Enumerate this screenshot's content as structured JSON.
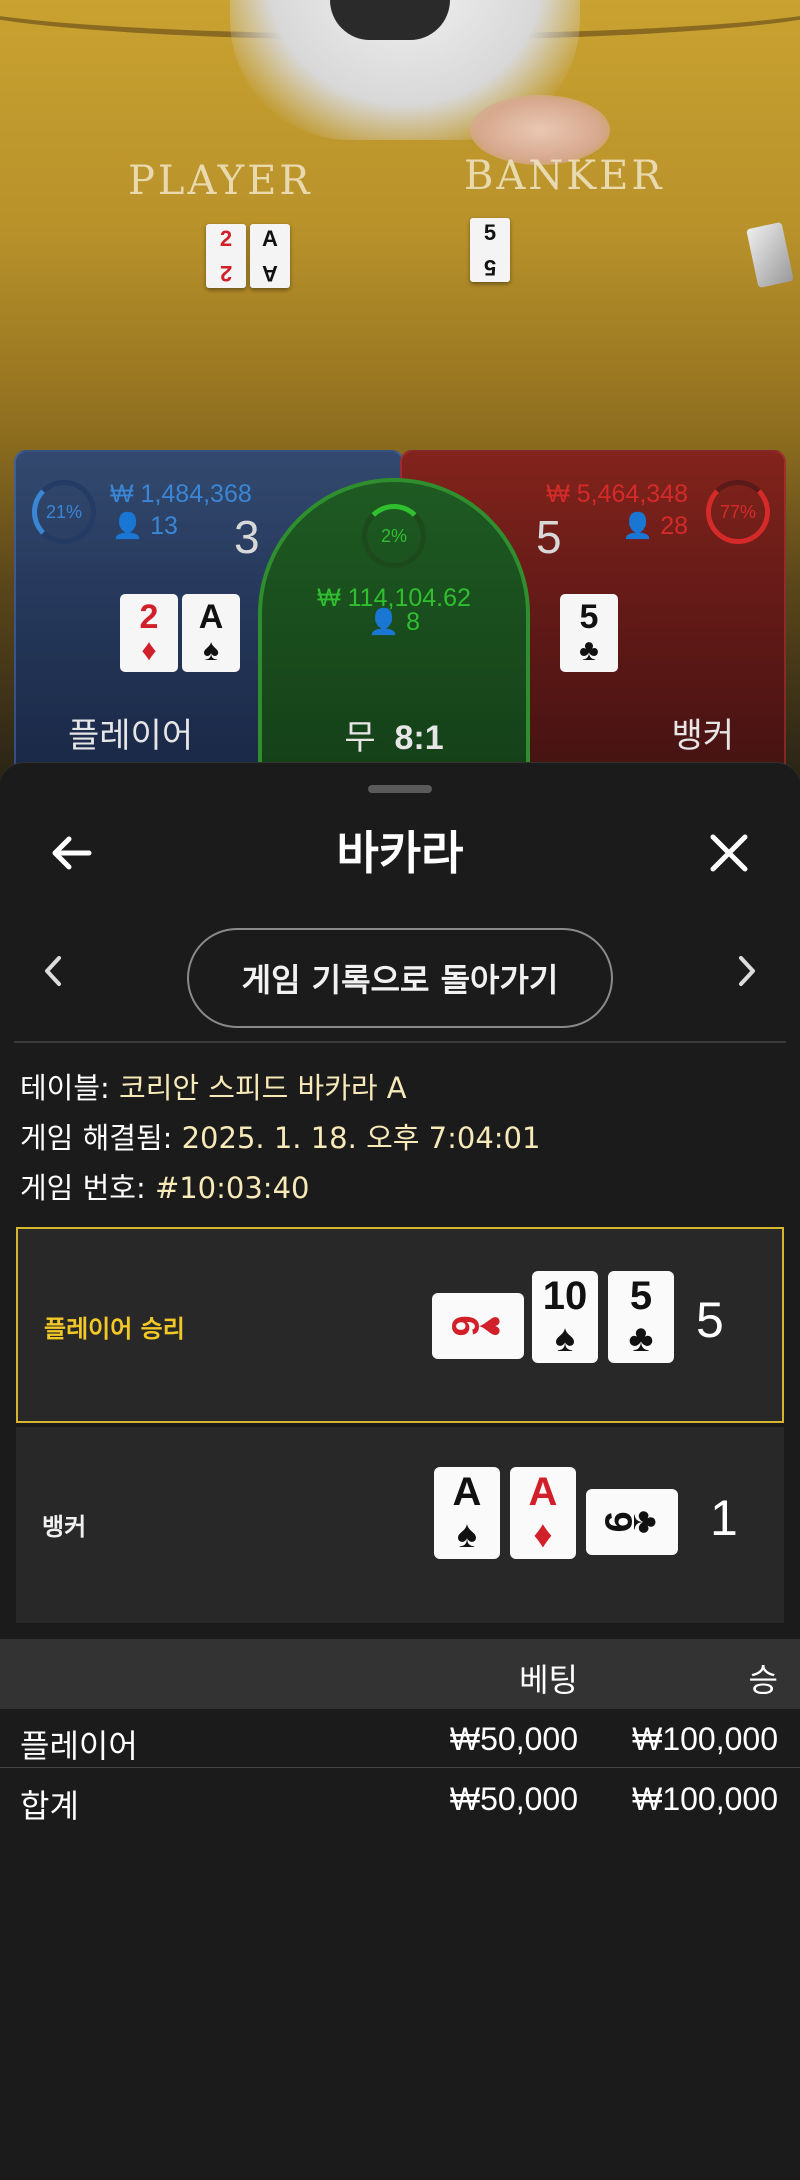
{
  "table_view": {
    "felt_player_label": "PLAYER",
    "felt_banker_label": "BANKER",
    "felt_player_cards": [
      {
        "rank": "2",
        "suit": "♦",
        "color": "red"
      },
      {
        "rank": "A",
        "suit": "♠",
        "color": "black"
      }
    ],
    "felt_banker_cards": [
      {
        "rank": "5",
        "suit": "♣",
        "color": "black"
      }
    ]
  },
  "bet_spots": {
    "player": {
      "percent": "21%",
      "amount": "₩ 1,484,368",
      "bettors": "13",
      "score": "3",
      "name": "플레이어",
      "cards": [
        {
          "rank": "2",
          "suit": "♦",
          "color": "red"
        },
        {
          "rank": "A",
          "suit": "♠",
          "color": "black"
        }
      ],
      "color": "#3a86d6"
    },
    "tie": {
      "percent": "2%",
      "amount": "₩ 114,104.62",
      "bettors": "8",
      "name": "무",
      "payout": "8:1",
      "color": "#2fbf2f"
    },
    "banker": {
      "percent": "77%",
      "amount": "₩ 5,464,348",
      "bettors": "28",
      "score": "5",
      "name": "뱅커",
      "cards": [
        {
          "rank": "5",
          "suit": "♣",
          "color": "black"
        }
      ],
      "color": "#d42a2a"
    }
  },
  "sheet": {
    "title": "바카라",
    "back_icon": "arrow-left-icon",
    "close_icon": "close-icon",
    "history_button": "게임 기록으로 돌아가기",
    "info": {
      "table_label": "테이블: ",
      "table_value": "코리안 스피드 바카라 A",
      "resolved_label": "게임 해결됨: ",
      "resolved_value": "2025. 1. 18. 오후 7:04:01",
      "number_label": "게임 번호: ",
      "number_value": "#10:03:40"
    },
    "results": [
      {
        "label": "플레이어 승리",
        "winner": true,
        "score": "5",
        "cards": [
          {
            "rank": "6",
            "suit": "♥",
            "color": "red",
            "sideways": true
          },
          {
            "rank": "10",
            "suit": "♠",
            "color": "black",
            "sideways": false
          },
          {
            "rank": "5",
            "suit": "♣",
            "color": "black",
            "sideways": false
          }
        ]
      },
      {
        "label": "뱅커",
        "winner": false,
        "score": "1",
        "cards": [
          {
            "rank": "A",
            "suit": "♠",
            "color": "black",
            "sideways": false
          },
          {
            "rank": "A",
            "suit": "♦",
            "color": "red",
            "sideways": false
          },
          {
            "rank": "9",
            "suit": "♣",
            "color": "black",
            "sideways": true
          }
        ]
      }
    ],
    "bets_table": {
      "columns": [
        "베팅",
        "승"
      ],
      "rows": [
        {
          "name": "플레이어",
          "bet": "₩50,000",
          "win": "₩100,000"
        }
      ],
      "total": {
        "name": "합계",
        "bet": "₩50,000",
        "win": "₩100,000"
      }
    }
  }
}
